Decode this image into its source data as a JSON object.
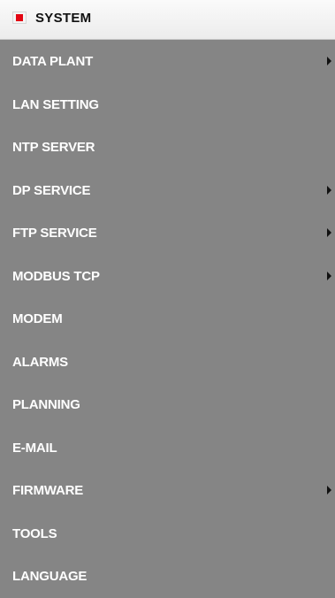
{
  "header": {
    "label": "SYSTEM",
    "icon": "red-square-icon",
    "icon_color": "#e30613"
  },
  "colors": {
    "menu_background": "#858585",
    "item_text": "#ffffff",
    "header_background": "#f5f5f5"
  },
  "menu": {
    "items": [
      {
        "label": "DATA PLANT",
        "has_submenu": true
      },
      {
        "label": "LAN SETTING",
        "has_submenu": false
      },
      {
        "label": "NTP SERVER",
        "has_submenu": false
      },
      {
        "label": "DP SERVICE",
        "has_submenu": true
      },
      {
        "label": "FTP SERVICE",
        "has_submenu": true
      },
      {
        "label": "MODBUS TCP",
        "has_submenu": true
      },
      {
        "label": "MODEM",
        "has_submenu": false
      },
      {
        "label": "ALARMS",
        "has_submenu": false
      },
      {
        "label": "PLANNING",
        "has_submenu": false
      },
      {
        "label": "E-MAIL",
        "has_submenu": false
      },
      {
        "label": "FIRMWARE",
        "has_submenu": true
      },
      {
        "label": "TOOLS",
        "has_submenu": false
      },
      {
        "label": "LANGUAGE",
        "has_submenu": false
      }
    ]
  }
}
